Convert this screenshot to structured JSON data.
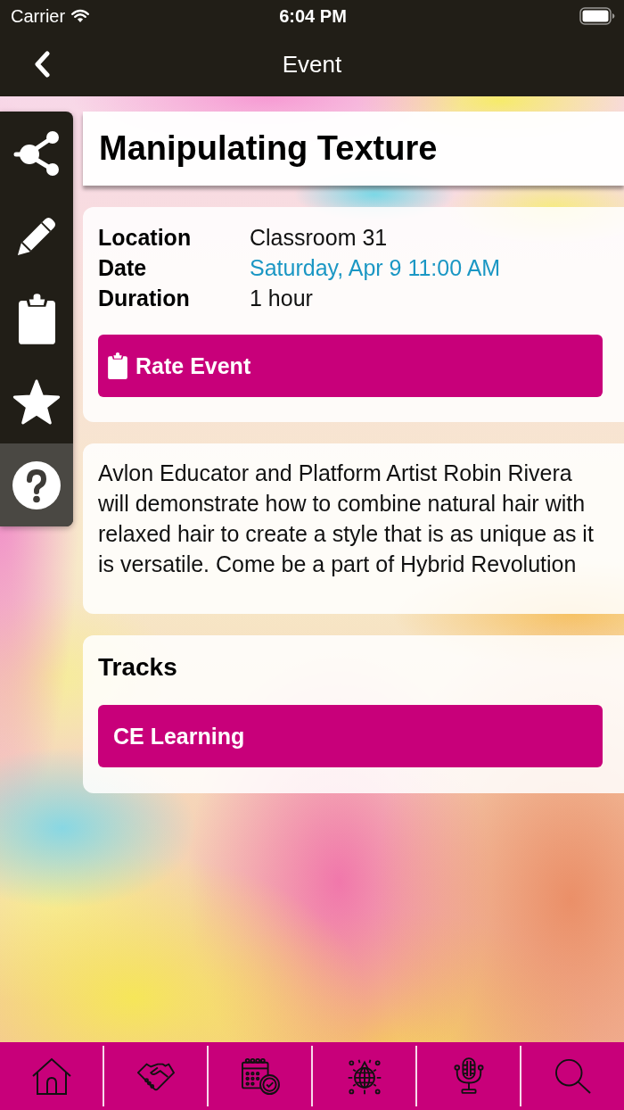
{
  "status_bar": {
    "carrier": "Carrier",
    "time": "6:04 PM"
  },
  "nav_bar": {
    "title": "Event"
  },
  "sidebar": {
    "items": [
      {
        "kind": "share",
        "selected": false
      },
      {
        "kind": "edit",
        "selected": false
      },
      {
        "kind": "clipboard",
        "selected": false
      },
      {
        "kind": "star",
        "selected": false
      },
      {
        "kind": "help",
        "selected": true
      }
    ]
  },
  "event": {
    "title": "Manipulating Texture",
    "details": [
      {
        "label": "Location",
        "value": "Classroom 31",
        "kind": "text"
      },
      {
        "label": "Date",
        "value": "Saturday, Apr 9 11:00 AM",
        "kind": "link"
      },
      {
        "label": "Duration",
        "value": "1 hour",
        "kind": "text"
      }
    ],
    "rate_button": {
      "label": "Rate Event"
    },
    "description": "Avlon Educator and Platform Artist Robin Rivera will demonstrate how to combine natural hair with relaxed hair to create a style that is as unique as it is versatile. Come be a part of Hybrid Revolution"
  },
  "tracks": {
    "heading": "Tracks",
    "items": [
      {
        "label": "CE Learning"
      }
    ]
  },
  "tab_bar": {
    "items": [
      {
        "kind": "home"
      },
      {
        "kind": "handshake"
      },
      {
        "kind": "calendar"
      },
      {
        "kind": "disco"
      },
      {
        "kind": "microphone"
      },
      {
        "kind": "search"
      }
    ]
  }
}
